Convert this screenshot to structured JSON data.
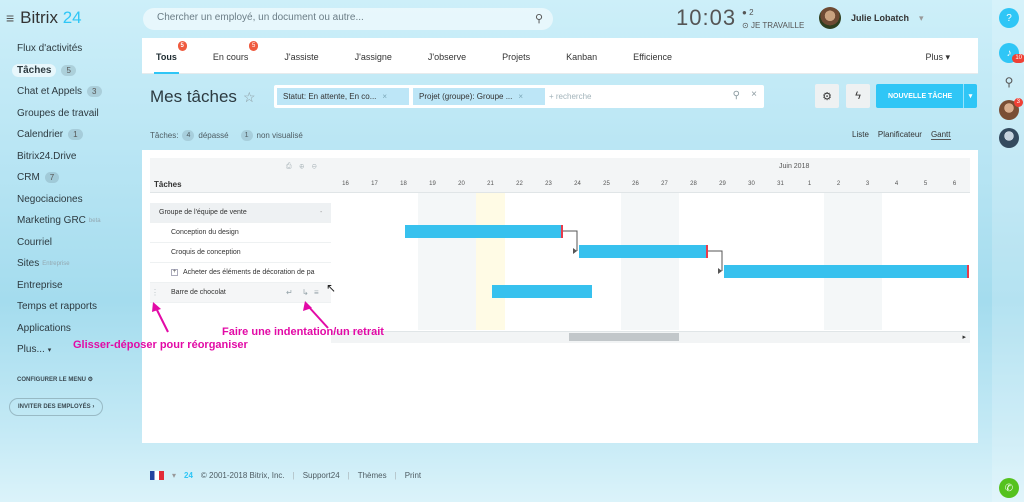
{
  "app": {
    "brand_a": "Bitrix",
    "brand_b": "24"
  },
  "search": {
    "placeholder": "Chercher un employé, un document ou autre..."
  },
  "clock": {
    "time": "10:03",
    "count": "2",
    "status": "JE TRAVAILLE"
  },
  "user": {
    "name": "Julie Lobatch"
  },
  "sidebar": {
    "items": [
      {
        "label": "Flux d'activités"
      },
      {
        "label": "Tâches",
        "count": "5",
        "active": true
      },
      {
        "label": "Chat et Appels",
        "count": "3"
      },
      {
        "label": "Groupes de travail"
      },
      {
        "label": "Calendrier",
        "count": "1"
      },
      {
        "label": "Bitrix24.Drive"
      },
      {
        "label": "CRM",
        "count": "7"
      },
      {
        "label": "Negociaciones"
      },
      {
        "label": "Marketing GRC",
        "extra": "beta"
      },
      {
        "label": "Courriel"
      },
      {
        "label": "Sites",
        "extra": "Entreprise"
      },
      {
        "label": "Entreprise"
      },
      {
        "label": "Temps et rapports"
      },
      {
        "label": "Applications"
      },
      {
        "label": "Plus..."
      }
    ],
    "configure": "CONFIGURER LE MENU",
    "invite": "INVITER DES EMPLOYÉS"
  },
  "tabs": [
    {
      "label": "Tous",
      "badge": "5"
    },
    {
      "label": "En cours",
      "badge": "5"
    },
    {
      "label": "J'assiste"
    },
    {
      "label": "J'assigne"
    },
    {
      "label": "J'observe"
    },
    {
      "label": "Projets"
    },
    {
      "label": "Kanban"
    },
    {
      "label": "Efficience"
    }
  ],
  "more_label": "Plus",
  "page": {
    "title": "Mes tâches"
  },
  "filter": {
    "chips": [
      "Statut: En attente, En co...",
      "Projet (groupe): Groupe ..."
    ],
    "placeholder": "+ recherche"
  },
  "new_task_label": "NOUVELLE TÂCHE",
  "stats": {
    "label": "Tâches:",
    "overdue_count": "4",
    "overdue_label": "dépassé",
    "unseen_count": "1",
    "unseen_label": "non visualisé"
  },
  "views": [
    "Liste",
    "Planificateur",
    "Gantt"
  ],
  "gantt": {
    "column_header": "Tâches",
    "month": "Juin 2018",
    "days": [
      "16",
      "17",
      "18",
      "19",
      "20",
      "21",
      "22",
      "23",
      "24",
      "25",
      "26",
      "27",
      "28",
      "29",
      "30",
      "31",
      "1",
      "2",
      "3",
      "4",
      "5",
      "6"
    ],
    "rows": [
      {
        "label": "Groupe de l'équipe de vente",
        "type": "group"
      },
      {
        "label": "Conception du design",
        "start_day": "18",
        "end_day": "23"
      },
      {
        "label": "Croquis de conception",
        "start_day": "24",
        "end_day": "28"
      },
      {
        "label": "Acheter des éléments de décoration de pa",
        "start_day": "29",
        "end_day": "6"
      },
      {
        "label": "Barre de chocolat",
        "start_day": "21",
        "end_day": "24"
      }
    ]
  },
  "annotations": {
    "drag": "Glisser-déposer pour réorganiser",
    "indent": "Faire une indentation/un retrait"
  },
  "footer": {
    "copyright": "© 2001-2018 Bitrix, Inc.",
    "support": "Support24",
    "themes": "Thèmes",
    "print": "Print"
  },
  "rail": {
    "notif_badge": "10",
    "avatar_badge": "3"
  }
}
